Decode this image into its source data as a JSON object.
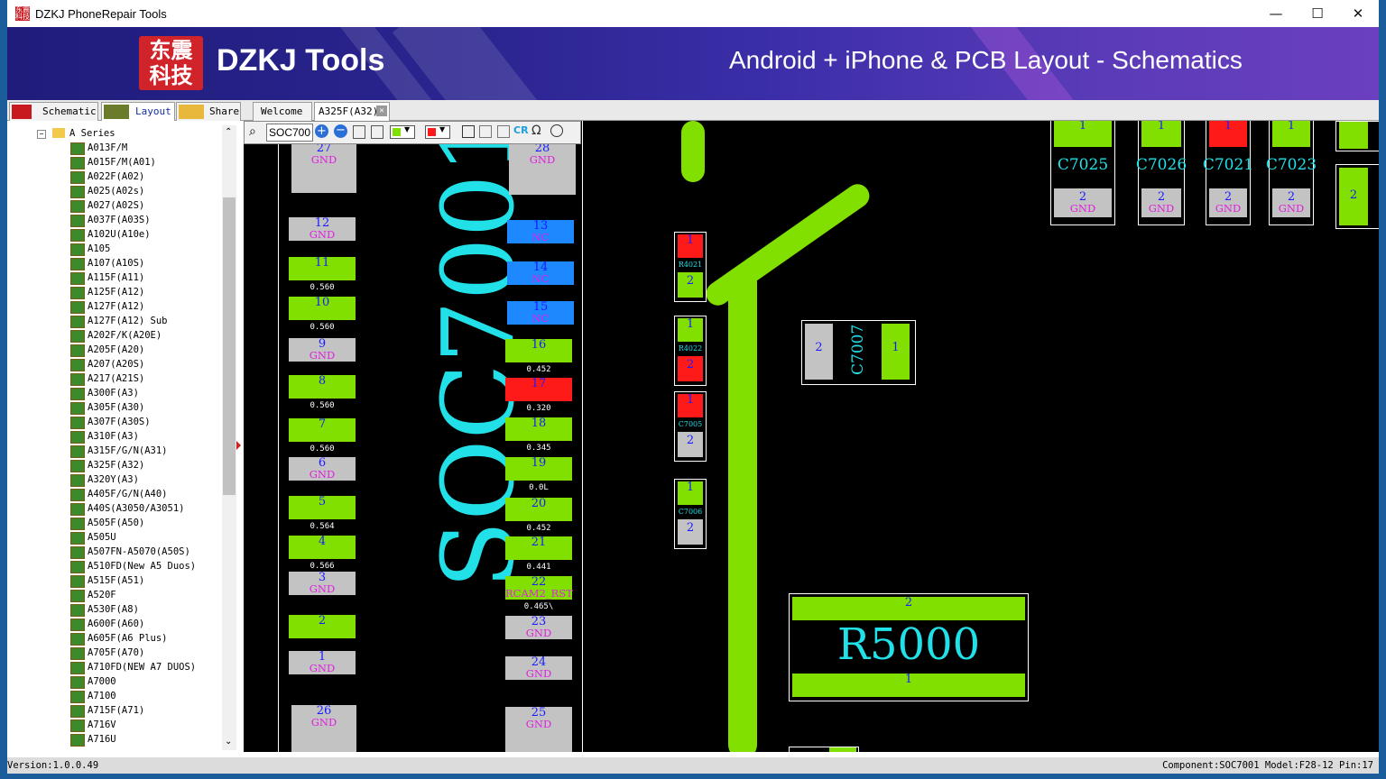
{
  "window": {
    "title": "DZKJ PhoneRepair Tools",
    "min": "—",
    "max": "☐",
    "close": "✕"
  },
  "banner": {
    "logo_line1": "东震",
    "logo_line2": "科技",
    "brand": "DZKJ Tools",
    "tagline": "Android + iPhone & PCB Layout - Schematics"
  },
  "tabs": {
    "schematic": "Schematic",
    "layout": "Layout",
    "share": "Share",
    "welcome": "Welcome",
    "doc": "A325F(A32)",
    "doc_close": "✕"
  },
  "tree": {
    "root": "A Series",
    "items": [
      "A013F/M",
      "A015F/M(A01)",
      "A022F(A02)",
      "A025(A02s)",
      "A027(A02S)",
      "A037F(A03S)",
      "A102U(A10e)",
      "A105",
      "A107(A10S)",
      "A115F(A11)",
      "A125F(A12)",
      "A127F(A12)",
      "A127F(A12) Sub",
      "A202F/K(A20E)",
      "A205F(A20)",
      "A207(A20S)",
      "A217(A21S)",
      "A300F(A3)",
      "A305F(A30)",
      "A307F(A30S)",
      "A310F(A3)",
      "A315F/G/N(A31)",
      "A325F(A32)",
      "A320Y(A3)",
      "A405F/G/N(A40)",
      "A40S(A3050/A3051)",
      "A505F(A50)",
      "A505U",
      "A507FN-A5070(A50S)",
      "A510FD(New A5 Duos)",
      "A515F(A51)",
      "A520F",
      "A530F(A8)",
      "A600F(A60)",
      "A605F(A6 Plus)",
      "A705F(A70)",
      "A710FD(NEW A7 DUOS)",
      "A7000",
      "A7100",
      "A715F(A71)",
      "A716V",
      "A716U"
    ]
  },
  "toolbar": {
    "search_value": "SOC700",
    "cr_label": "CR"
  },
  "board": {
    "component_label": "SOC7001",
    "left_pads": [
      {
        "n": "27",
        "s": "GND"
      },
      {
        "n": "12",
        "s": "GND"
      },
      {
        "n": "11",
        "v": "0.560"
      },
      {
        "n": "10",
        "v": "0.560"
      },
      {
        "n": "9",
        "s": "GND"
      },
      {
        "n": "8",
        "v": "0.560"
      },
      {
        "n": "7",
        "v": "0.560"
      },
      {
        "n": "6",
        "s": "GND"
      },
      {
        "n": "5",
        "v": "0.564"
      },
      {
        "n": "4",
        "v": "0.566"
      },
      {
        "n": "3",
        "s": "GND"
      },
      {
        "n": "2"
      },
      {
        "n": "1",
        "s": "GND"
      },
      {
        "n": "26",
        "s": "GND"
      }
    ],
    "right_pads": [
      {
        "n": "28",
        "s": "GND"
      },
      {
        "n": "13",
        "s": "NC"
      },
      {
        "n": "14",
        "s": "NC"
      },
      {
        "n": "15",
        "s": "NC"
      },
      {
        "n": "16",
        "v": "0.452"
      },
      {
        "n": "17",
        "v": "0.320"
      },
      {
        "n": "18",
        "v": "0.345"
      },
      {
        "n": "19",
        "v": "0.0L"
      },
      {
        "n": "20",
        "v": "0.452"
      },
      {
        "n": "21",
        "v": "0.441"
      },
      {
        "n": "22",
        "s": "RCAM2_RST",
        "v": "0.465\\"
      },
      {
        "n": "23",
        "s": "GND"
      },
      {
        "n": "24",
        "s": "GND"
      },
      {
        "n": "25",
        "s": "GND"
      }
    ],
    "caps_top": [
      {
        "name": "C7025",
        "p1": "1",
        "p2": "2",
        "s": "GND"
      },
      {
        "name": "C7026",
        "p1": "1",
        "p2": "2",
        "s": "GND"
      },
      {
        "name": "C7021",
        "p1": "1",
        "p2": "2",
        "s": "GND"
      },
      {
        "name": "C7023",
        "p1": "1",
        "p2": "2",
        "s": "GND"
      }
    ],
    "edge_pad": "2",
    "small_parts": [
      {
        "name": "R4021",
        "p1": "1",
        "p2": "2"
      },
      {
        "name": "R4022",
        "p1": "1",
        "p2": "2"
      },
      {
        "name": "C7005",
        "p1": "1",
        "p2": "2"
      },
      {
        "name": "C7006",
        "p1": "1",
        "p2": "2"
      }
    ],
    "c7007": {
      "name": "C7007",
      "p1": "1",
      "p2": "2"
    },
    "r5000": {
      "name": "R5000",
      "p1": "1",
      "p2": "2"
    }
  },
  "status": {
    "version": "Version:1.0.0.49",
    "component": "Component:SOC7001 Model:F28-12 Pin:17"
  }
}
